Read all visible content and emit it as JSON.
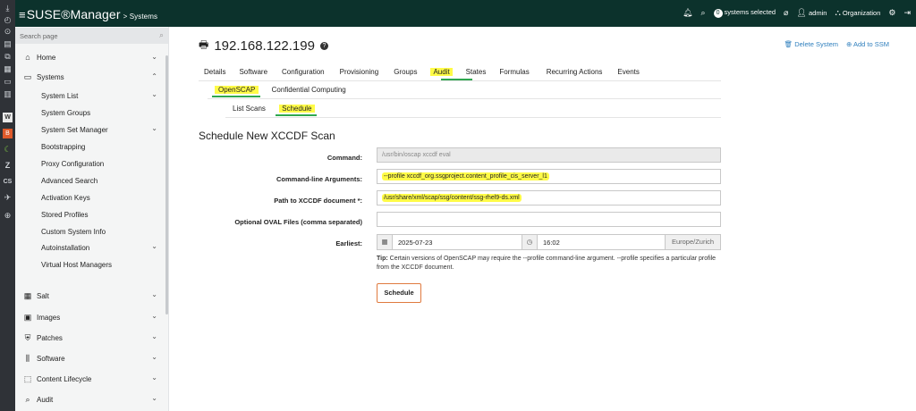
{
  "header": {
    "brand": "SUSE®Manager",
    "breadcrumb": "> Systems",
    "systems_selected_count": "0",
    "systems_selected_label": "systems selected",
    "user": "admin",
    "organization": "Organization"
  },
  "sidebar": {
    "search_placeholder": "Search page",
    "home": "Home",
    "systems": "Systems",
    "systems_items": [
      "System List",
      "System Groups",
      "System Set Manager",
      "Bootstrapping",
      "Proxy Configuration",
      "Advanced Search",
      "Activation Keys",
      "Stored Profiles",
      "Custom System Info",
      "Autoinstallation",
      "Virtual Host Managers"
    ],
    "lower": [
      "Salt",
      "Images",
      "Patches",
      "Software",
      "Content Lifecycle",
      "Audit"
    ]
  },
  "page": {
    "title": "192.168.122.199",
    "delete_system": "Delete System",
    "add_to_ssm": "Add to SSM",
    "tabs": [
      "Details",
      "Software",
      "Configuration",
      "Provisioning",
      "Groups",
      "Audit",
      "States",
      "Formulas",
      "Recurring Actions",
      "Events"
    ],
    "subtabs": [
      "OpenSCAP",
      "Confidential Computing"
    ],
    "subtabs2": [
      "List Scans",
      "Schedule"
    ]
  },
  "form": {
    "heading": "Schedule New XCCDF Scan",
    "command_label": "Command:",
    "command_value": "/usr/bin/oscap xccdf eval",
    "args_label": "Command-line Arguments:",
    "args_value": "--profile xccdf_org.ssgproject.content_profile_cis_server_l1",
    "path_label": "Path to XCCDF document *:",
    "path_value": "/usr/share/xml/scap/ssg/content/ssg-rhel9-ds.xml",
    "oval_label": "Optional OVAL Files (comma separated)",
    "oval_value": "",
    "earliest_label": "Earliest:",
    "date": "2025-07-23",
    "time": "16:02",
    "timezone": "Europe/Zurich",
    "tip_bold": "Tip:",
    "tip_text": "Certain versions of OpenSCAP may require the --profile command-line argument. --profile specifies a particular profile from the XCCDF document.",
    "schedule_button": "Schedule"
  },
  "colors": {
    "header_bg": "#0c322c",
    "accent_green": "#2fa84f",
    "highlight": "#fffb47",
    "button_border": "#e07a3f",
    "link": "#2f7fbd"
  }
}
